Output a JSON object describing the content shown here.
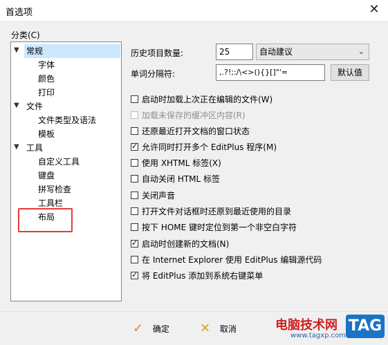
{
  "window": {
    "title": "首选项",
    "close_glyph": "✕"
  },
  "category": {
    "label": "分类(C)",
    "tree": [
      {
        "label": "常规",
        "expanded": true,
        "selected": true
      },
      {
        "label": "字体"
      },
      {
        "label": "颜色"
      },
      {
        "label": "打印"
      },
      {
        "label": "文件",
        "expanded": true
      },
      {
        "label": "文件类型及语法"
      },
      {
        "label": "模板"
      },
      {
        "label": "工具",
        "expanded": true
      },
      {
        "label": "自定义工具"
      },
      {
        "label": "键盘"
      },
      {
        "label": "拼写检查"
      },
      {
        "label": "工具栏"
      },
      {
        "label": "布局"
      }
    ],
    "expand_glyph": "✓"
  },
  "settings": {
    "history_label": "历史项目数量:",
    "history_value": "25",
    "history_mode": "自动建议",
    "delim_label": "单词分隔符:",
    "delim_value": ",.?!;:/\\<>(){}[]\"'=",
    "default_button": "默认值",
    "checkboxes": [
      {
        "label": "启动时加载上次正在编辑的文件(W)",
        "checked": false,
        "disabled": false
      },
      {
        "label": "加载未保存的缓冲区内容(R)",
        "checked": false,
        "disabled": true
      },
      {
        "label": "还原最近打开文档的窗口状态",
        "checked": false,
        "disabled": false
      },
      {
        "label": "允许同时打开多个 EditPlus 程序(M)",
        "checked": true,
        "disabled": false
      },
      {
        "label": "使用 XHTML 标签(X)",
        "checked": false,
        "disabled": false
      },
      {
        "label": "自动关闭 HTML 标签",
        "checked": false,
        "disabled": false
      },
      {
        "label": "关闭声音",
        "checked": false,
        "disabled": false
      },
      {
        "label": "打开文件对话框时还原到最近使用的目录",
        "checked": false,
        "disabled": false
      },
      {
        "label": "按下 HOME 键时定位到第一个非空白字符",
        "checked": false,
        "disabled": false
      },
      {
        "label": "启动时创建新的文档(N)",
        "checked": true,
        "disabled": false
      },
      {
        "label": "在 Internet Explorer 使用 EditPlus 编辑源代码",
        "checked": false,
        "disabled": false
      },
      {
        "label": "将 EditPlus 添加到系统右键菜单",
        "checked": true,
        "disabled": false
      }
    ]
  },
  "footer": {
    "ok_label": "确定",
    "cancel_label": "取消",
    "ok_icon": "✓",
    "cancel_icon": "✕"
  },
  "watermark": {
    "site_name": "电脑技术网",
    "url": "www.tagxp.com",
    "badge": "TAG"
  },
  "colors": {
    "selection": "#cce8ff",
    "highlight_border": "#e53935",
    "ok_icon": "#e8822a",
    "cancel_icon": "#d9a21a"
  }
}
